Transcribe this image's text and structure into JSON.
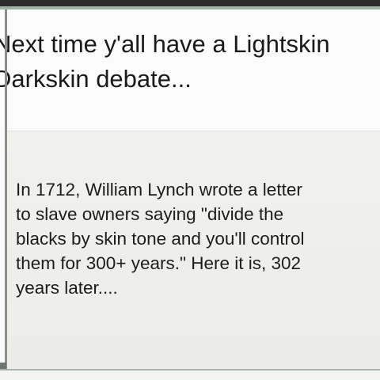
{
  "post": {
    "headline_lines": [
      "Next time y'all have a Lightskin",
      "Darkskin debate..."
    ],
    "quote_lines": [
      "In 1712, William Lynch wrote a letter",
      "to slave owners saying \"divide the",
      "blacks by skin tone and you'll control",
      "them for 300+ years.\" Here it is, 302",
      "years later...."
    ]
  },
  "colors": {
    "top_bar": "#2c2c2c",
    "accent_rule": "#9fb3a6",
    "card_background": "#eeeeea",
    "text": "#1a1a1a"
  }
}
